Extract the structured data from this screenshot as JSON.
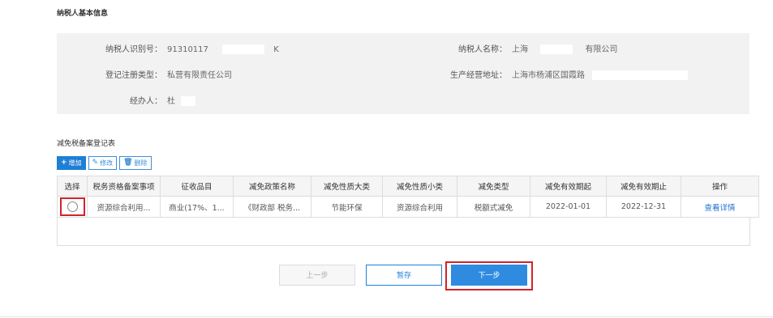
{
  "section_title": "纳税人基本信息",
  "basic_info": {
    "taxpayer_id_label": "纳税人识别号：",
    "taxpayer_id_prefix": "91310117",
    "taxpayer_id_suffix": "K",
    "taxpayer_name_label": "纳税人名称：",
    "taxpayer_name_prefix": "上海",
    "taxpayer_name_suffix": "有限公司",
    "reg_type_label": "登记注册类型：",
    "reg_type_value": "私营有限责任公司",
    "address_label": "生产经营地址：",
    "address_value": "上海市杨浦区国霞路",
    "agent_label": "经办人：",
    "agent_value": "杜"
  },
  "table_title": "减免税备案登记表",
  "toolbar": {
    "add_label": "增加",
    "edit_label": "修改",
    "delete_label": "删除"
  },
  "table": {
    "headers": [
      "选择",
      "税务资格备案事项",
      "征收品目",
      "减免政策名称",
      "减免性质大类",
      "减免性质小类",
      "减免类型",
      "减免有效期起",
      "减免有效期止",
      "操作"
    ],
    "rows": [
      {
        "matter": "资源综合利用...",
        "item": "商业(17%、1...",
        "policy": "《财政部 税务...",
        "category": "节能环保",
        "subcategory": "资源综合利用",
        "type": "税额式减免",
        "start": "2022-01-01",
        "end": "2022-12-31",
        "action": "查看详情"
      }
    ]
  },
  "buttons": {
    "prev": "上一步",
    "save": "暂存",
    "next": "下一步"
  },
  "colors": {
    "accent": "#1f7fd6",
    "highlight_frame": "#d2232a",
    "panel_bg": "#f2f2f2"
  }
}
